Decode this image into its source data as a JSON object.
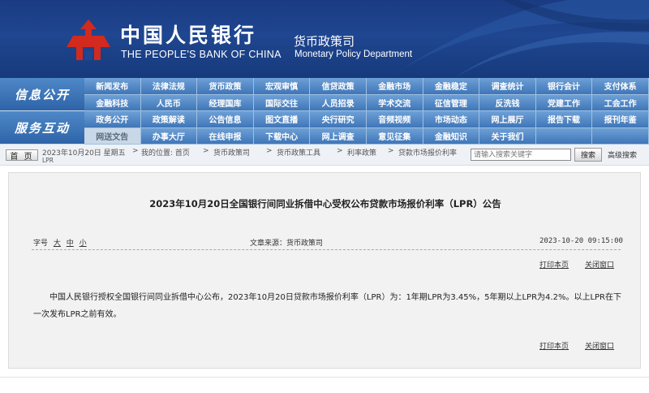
{
  "header": {
    "bank_name_cn": "中国人民银行",
    "bank_name_en": "THE PEOPLE'S BANK OF CHINA",
    "dept_name_cn": "货币政策司",
    "dept_name_en": "Monetary Policy Department"
  },
  "nav": {
    "category_1": "信息公开",
    "category_2": "服务互动",
    "rows": [
      [
        "新闻发布",
        "法律法规",
        "货币政策",
        "宏观审慎",
        "信贷政策",
        "金融市场",
        "金融稳定",
        "调查统计",
        "银行会计",
        "支付体系"
      ],
      [
        "金融科技",
        "人民币",
        "经理国库",
        "国际交往",
        "人员招录",
        "学术交流",
        "征信管理",
        "反洗钱",
        "党建工作",
        "工会工作"
      ],
      [
        "政务公开",
        "政策解读",
        "公告信息",
        "图文直播",
        "央行研究",
        "音频视频",
        "市场动态",
        "网上展厅",
        "报告下载",
        "报刊年鉴"
      ],
      [
        "网送文告",
        "办事大厅",
        "在线申报",
        "下载中心",
        "网上调查",
        "意见征集",
        "金融知识",
        "关于我们",
        "",
        ""
      ]
    ]
  },
  "breadcrumb": {
    "home": "首 页",
    "date": "2023年10月20日 星期五",
    "location_label": "我的位置: 首页",
    "items": [
      "货币政策司",
      "货币政策工具",
      "利率政策",
      "贷款市场报价利率"
    ],
    "overflow": "LPR",
    "separator": ">"
  },
  "search": {
    "placeholder": "请输入搜索关键字",
    "button": "搜索",
    "advanced": "高级搜索"
  },
  "article": {
    "title": "2023年10月20日全国银行间同业拆借中心受权公布贷款市场报价利率（LPR）公告",
    "font_size_label": "字号",
    "font_sizes": [
      "大",
      "中",
      "小"
    ],
    "source": "文章来源：货币政策司",
    "datetime": "2023-10-20 09:15:00",
    "print": "打印本页",
    "close": "关闭窗口",
    "body": "中国人民银行授权全国银行间同业拆借中心公布，2023年10月20日贷款市场报价利率（LPR）为：1年期LPR为3.45%，5年期以上LPR为4.2%。以上LPR在下一次发布LPR之前有效。"
  },
  "colors": {
    "header_blue": "#1f4690",
    "nav_blue": "#3f76b8",
    "logo_red": "#d22a1e"
  }
}
